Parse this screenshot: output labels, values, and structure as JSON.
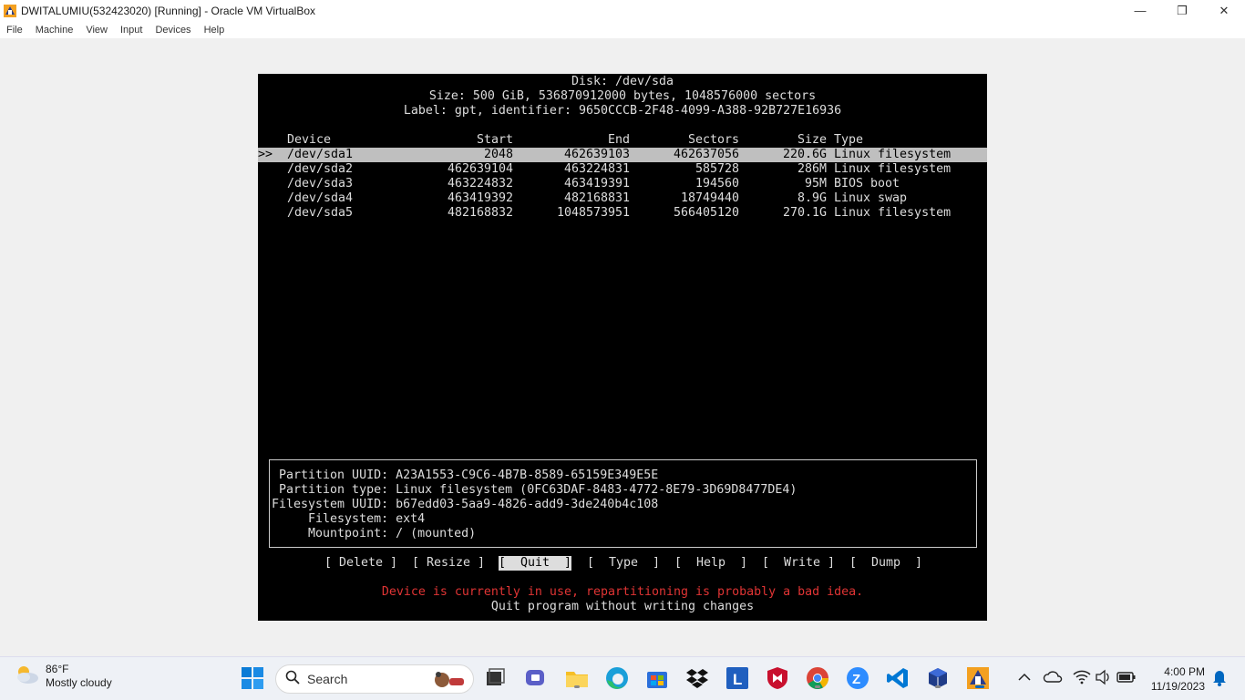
{
  "window": {
    "title": "DWITALUMIU(532423020) [Running] - Oracle VM VirtualBox",
    "minimize": "—",
    "restore": "❐",
    "close": "✕"
  },
  "menu": [
    "File",
    "Machine",
    "View",
    "Input",
    "Devices",
    "Help"
  ],
  "terminal": {
    "header": {
      "disk": "Disk: /dev/sda",
      "size": "Size: 500 GiB, 536870912000 bytes, 1048576000 sectors",
      "label": "Label: gpt, identifier: 9650CCCB-2F48-4099-A388-92B727E16936"
    },
    "columns": {
      "device": "Device",
      "start": "Start",
      "end": "End",
      "sectors": "Sectors",
      "size": "Size",
      "type": "Type"
    },
    "cursor": ">>",
    "partitions": [
      {
        "device": "/dev/sda1",
        "start": "2048",
        "end": "462639103",
        "sectors": "462637056",
        "size": "220.6G",
        "type": "Linux filesystem"
      },
      {
        "device": "/dev/sda2",
        "start": "462639104",
        "end": "463224831",
        "sectors": "585728",
        "size": "286M",
        "type": "Linux filesystem"
      },
      {
        "device": "/dev/sda3",
        "start": "463224832",
        "end": "463419391",
        "sectors": "194560",
        "size": "95M",
        "type": "BIOS boot"
      },
      {
        "device": "/dev/sda4",
        "start": "463419392",
        "end": "482168831",
        "sectors": "18749440",
        "size": "8.9G",
        "type": "Linux swap"
      },
      {
        "device": "/dev/sda5",
        "start": "482168832",
        "end": "1048573951",
        "sectors": "566405120",
        "size": "270.1G",
        "type": "Linux filesystem"
      }
    ],
    "info": [
      " Partition UUID: A23A1553-C9C6-4B7B-8589-65159E349E5E",
      " Partition type: Linux filesystem (0FC63DAF-8483-4772-8E79-3D69D8477DE4)",
      "Filesystem UUID: b67edd03-5aa9-4826-add9-3de240b4c108",
      "     Filesystem: ext4",
      "     Mountpoint: / (mounted)"
    ],
    "buttons": [
      "[ Delete ]",
      "[ Resize ]",
      "[  Quit  ]",
      "[  Type  ]",
      "[  Help  ]",
      "[  Write ]",
      "[  Dump  ]"
    ],
    "warning": "Device is currently in use, repartitioning is probably a bad idea.",
    "hint": "Quit program without writing changes"
  },
  "taskbar": {
    "weather_temp": "86°F",
    "weather_desc": "Mostly cloudy",
    "search_placeholder": "Search",
    "time": "4:00 PM",
    "date": "11/19/2023"
  },
  "colors": {
    "accent": "#0067c0",
    "warning": "#e03434",
    "selection": "#bfbfbf"
  }
}
